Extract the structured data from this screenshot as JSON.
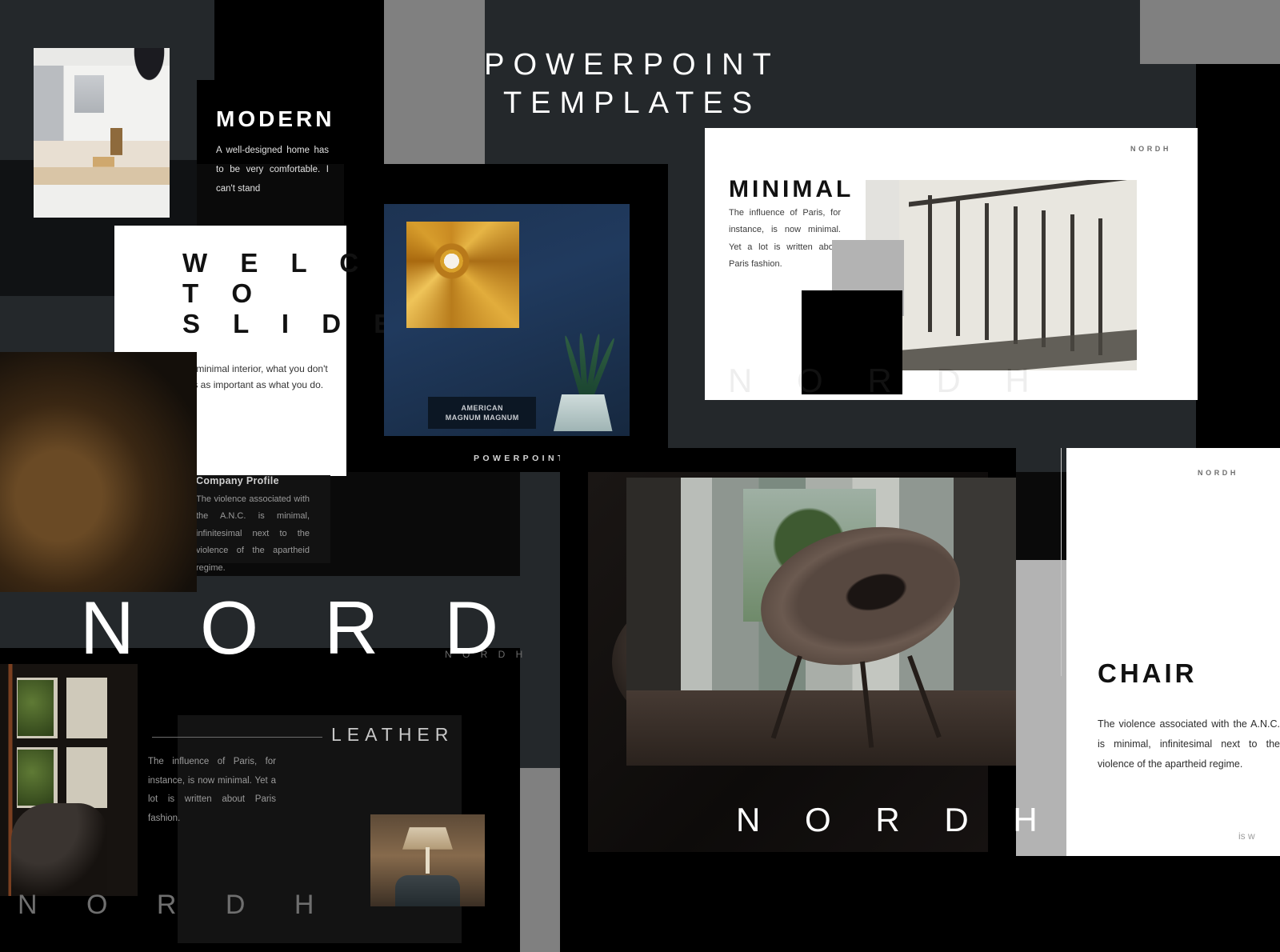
{
  "hero": {
    "line1": "POWERPOINT",
    "line2": "TEMPLATES"
  },
  "modern_slide": {
    "title": "MODERN",
    "body": "A well-designed home has to be very comfortable. I can't stand"
  },
  "welcome_slide": {
    "line1": "W E L C O M E",
    "line2": "T O",
    "line3": "S L I D E",
    "body": "In a minimal interior, what you don't do is as important as what you do."
  },
  "mirror_slide": {
    "poster_line1": "AMERICAN",
    "poster_line2": "MAGNUM MAGNUM",
    "footer": "POWERPOINT"
  },
  "minimal_slide": {
    "corner_tag": "NORDH",
    "title": "MINIMAL",
    "body": "The influence of Paris, for instance, is now minimal. Yet a lot is written about Paris fashion.",
    "wordmark": "N O R D H"
  },
  "company_profile": {
    "title": "Company Profile",
    "body": "The violence associated with the A.N.C. is minimal, infinitesimal next to the violence of the apartheid regime."
  },
  "nordh_banner": {
    "text": "N O R D H",
    "ghost": "N O R D H"
  },
  "leather_slide": {
    "title": "LEATHER",
    "body": "The influence of Paris, for instance, is now minimal. Yet a lot is written about Paris fashion."
  },
  "bottom_left": {
    "wordmark": "N O R D H"
  },
  "chair_photo_slide": {
    "wordmark": "N O R D H"
  },
  "chair_slide": {
    "corner_tag": "NORDH",
    "title": "CHAIR",
    "body": "The violence associated with the A.N.C. is minimal, infinitesimal next to the violence of the apartheid regime.",
    "cut_text": "is w"
  },
  "colors": {
    "dark_slate": "#24282b",
    "mid_gray": "#808080",
    "light_gray": "#b3b3b3",
    "black": "#000000",
    "white": "#ffffff",
    "navy": "#1d3352",
    "gold": "#c98a22"
  }
}
